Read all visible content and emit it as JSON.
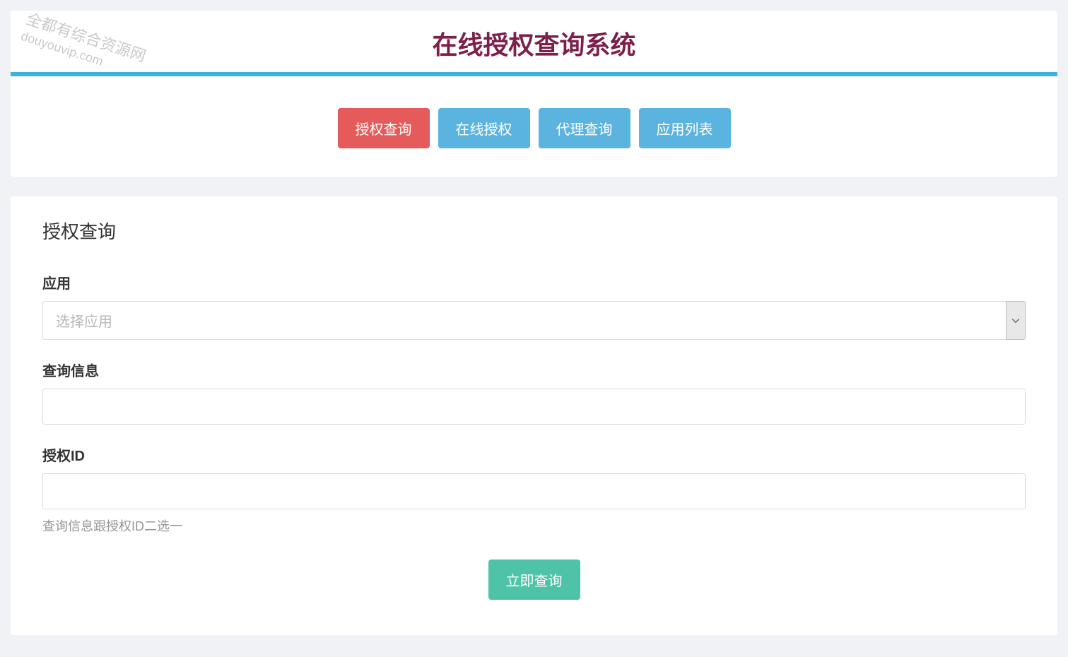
{
  "watermark": {
    "line1": "全都有综合资源网",
    "line2": "douyouvip.com"
  },
  "header": {
    "title": "在线授权查询系统"
  },
  "nav": {
    "buttons": [
      {
        "label": "授权查询",
        "variant": "danger"
      },
      {
        "label": "在线授权",
        "variant": "info"
      },
      {
        "label": "代理查询",
        "variant": "info"
      },
      {
        "label": "应用列表",
        "variant": "info"
      }
    ]
  },
  "form": {
    "title": "授权查询",
    "app_label": "应用",
    "app_placeholder": "选择应用",
    "query_info_label": "查询信息",
    "auth_id_label": "授权ID",
    "help_text": "查询信息跟授权ID二选一",
    "submit_label": "立即查询"
  }
}
